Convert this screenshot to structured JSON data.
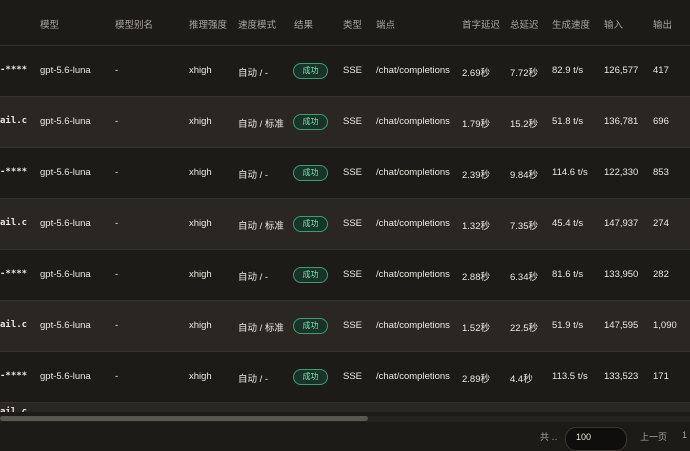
{
  "headers": {
    "model": "模型",
    "alias": "模型别名",
    "effort": "推理强度",
    "speed_mode": "速度模式",
    "result": "结果",
    "type": "类型",
    "endpoint": "端点",
    "first_latency": "首字延迟",
    "total_latency": "总延迟",
    "gen_speed": "生成速度",
    "input": "输入",
    "output": "输出"
  },
  "rows": [
    {
      "account": "-****",
      "model": "gpt-5.6-luna",
      "alias": "-",
      "effort": "xhigh",
      "speed_mode": "自动 / -",
      "result": "成功",
      "type": "SSE",
      "endpoint": "/chat/completions",
      "first_latency": "2.69秒",
      "total_latency": "7.72秒",
      "gen_speed": "82.9 t/s",
      "input": "126,577",
      "output": "417"
    },
    {
      "account": "ail.c",
      "model": "gpt-5.6-luna",
      "alias": "-",
      "effort": "xhigh",
      "speed_mode": "自动 / 标准",
      "result": "成功",
      "type": "SSE",
      "endpoint": "/chat/completions",
      "first_latency": "1.79秒",
      "total_latency": "15.2秒",
      "gen_speed": "51.8 t/s",
      "input": "136,781",
      "output": "696"
    },
    {
      "account": "-****",
      "model": "gpt-5.6-luna",
      "alias": "-",
      "effort": "xhigh",
      "speed_mode": "自动 / -",
      "result": "成功",
      "type": "SSE",
      "endpoint": "/chat/completions",
      "first_latency": "2.39秒",
      "total_latency": "9.84秒",
      "gen_speed": "114.6 t/s",
      "input": "122,330",
      "output": "853"
    },
    {
      "account": "ail.c",
      "model": "gpt-5.6-luna",
      "alias": "-",
      "effort": "xhigh",
      "speed_mode": "自动 / 标准",
      "result": "成功",
      "type": "SSE",
      "endpoint": "/chat/completions",
      "first_latency": "1.32秒",
      "total_latency": "7.35秒",
      "gen_speed": "45.4 t/s",
      "input": "147,937",
      "output": "274"
    },
    {
      "account": "-****",
      "model": "gpt-5.6-luna",
      "alias": "-",
      "effort": "xhigh",
      "speed_mode": "自动 / -",
      "result": "成功",
      "type": "SSE",
      "endpoint": "/chat/completions",
      "first_latency": "2.88秒",
      "total_latency": "6.34秒",
      "gen_speed": "81.6 t/s",
      "input": "133,950",
      "output": "282"
    },
    {
      "account": "ail.c",
      "model": "gpt-5.6-luna",
      "alias": "-",
      "effort": "xhigh",
      "speed_mode": "自动 / 标准",
      "result": "成功",
      "type": "SSE",
      "endpoint": "/chat/completions",
      "first_latency": "1.52秒",
      "total_latency": "22.5秒",
      "gen_speed": "51.9 t/s",
      "input": "147,595",
      "output": "1,090"
    },
    {
      "account": "-****",
      "model": "gpt-5.6-luna",
      "alias": "-",
      "effort": "xhigh",
      "speed_mode": "自动 / -",
      "result": "成功",
      "type": "SSE",
      "endpoint": "/chat/completions",
      "first_latency": "2.89秒",
      "total_latency": "4.4秒",
      "gen_speed": "113.5 t/s",
      "input": "133,523",
      "output": "171"
    }
  ],
  "partial_row": {
    "account": "ail.c"
  },
  "pager": {
    "total_label": "共 ‥",
    "page_size": "100",
    "prev_label": "上一页",
    "page_number": "1"
  },
  "colors": {
    "background": "#1d1b18",
    "row_alt": "#2a2723",
    "success_border": "#3f9c6e",
    "success_text": "#7fe0ac"
  }
}
